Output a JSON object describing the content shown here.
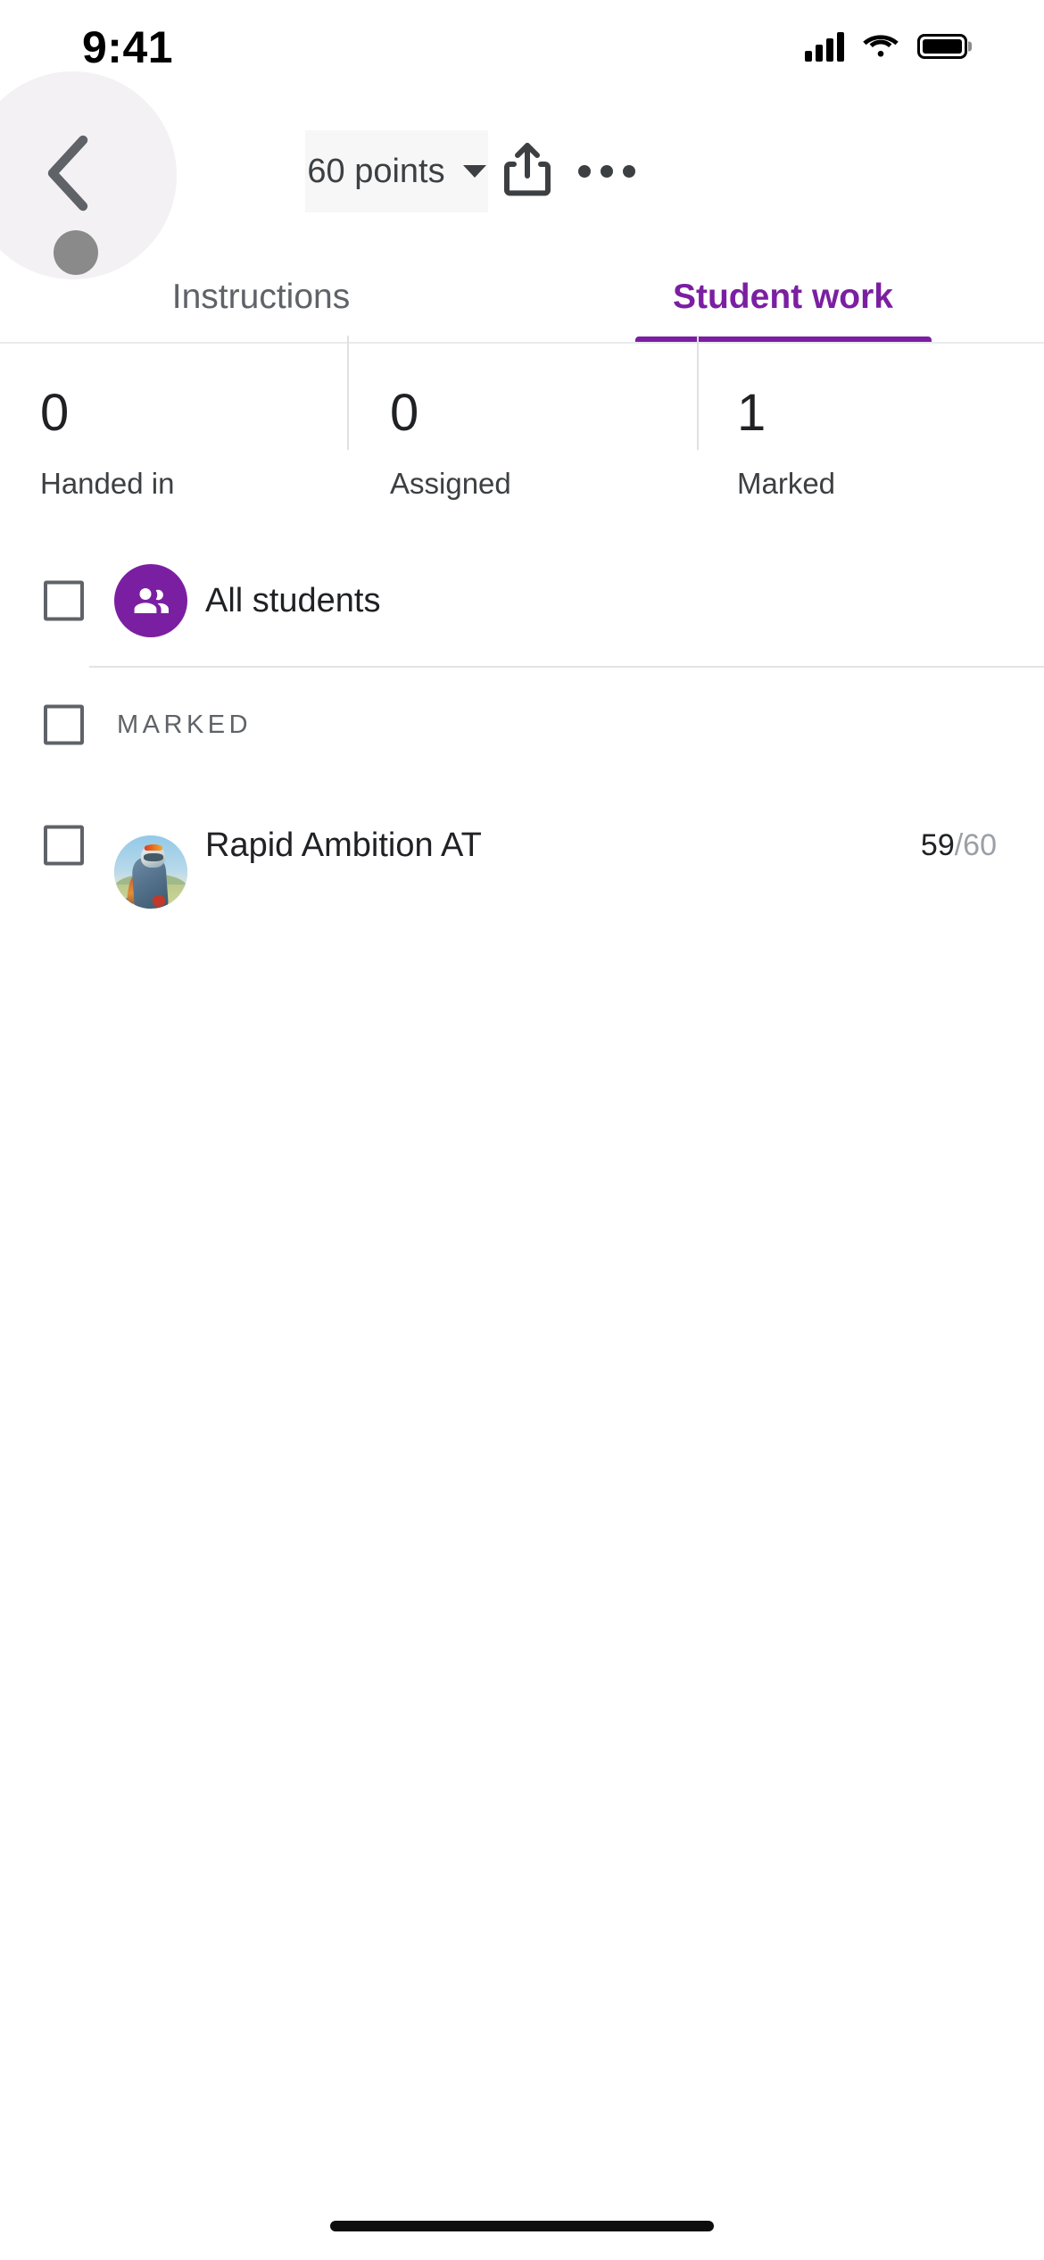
{
  "status_bar": {
    "time": "9:41",
    "signal_icon": "cellular-signal-icon",
    "wifi_icon": "wifi-icon",
    "battery_icon": "battery-full-icon"
  },
  "app_bar": {
    "back_icon": "chevron-left-icon",
    "points_chip": {
      "label": "60 points",
      "caret_icon": "chevron-down-icon"
    },
    "share_icon": "share-icon",
    "more_icon": "more-horizontal-icon",
    "touch_indicator": "touch-point-indicator"
  },
  "tabs": [
    {
      "label": "Instructions",
      "active": false
    },
    {
      "label": "Student work",
      "active": true
    }
  ],
  "stats": [
    {
      "value": "0",
      "label": "Handed in"
    },
    {
      "value": "0",
      "label": "Assigned"
    },
    {
      "value": "1",
      "label": "Marked"
    }
  ],
  "all_students_row": {
    "label": "All students",
    "avatar_icon": "group-people-icon",
    "checkbox_icon": "checkbox-unchecked-icon"
  },
  "marked_section": {
    "label": "MARKED",
    "checkbox_icon": "checkbox-unchecked-icon"
  },
  "students": [
    {
      "name": "Rapid Ambition AT",
      "score_earned": "59",
      "score_total": "/60",
      "avatar_icon": "student-photo-avatar",
      "checkbox_icon": "checkbox-unchecked-icon"
    }
  ],
  "colors": {
    "accent_purple": "#7b1fa2",
    "text_primary": "#202124",
    "text_secondary": "#5f6368",
    "text_muted": "#9aa0a6",
    "chip_background": "#f7f7f8",
    "divider": "#e3e3e3",
    "ripple": "#f4f1f4"
  },
  "home_indicator": "home-indicator"
}
